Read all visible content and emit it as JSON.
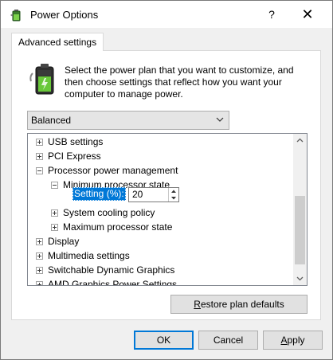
{
  "window": {
    "title": "Power Options",
    "help_glyph": "?",
    "close_glyph": "✕"
  },
  "tab": {
    "label": "Advanced settings"
  },
  "description": "Select the power plan that you want to customize, and then choose settings that reflect how you want your computer to manage power.",
  "plan_select": {
    "value": "Balanced"
  },
  "tree": {
    "items": [
      {
        "label": "USB settings",
        "expander": "+"
      },
      {
        "label": "PCI Express",
        "expander": "+"
      },
      {
        "label": "Processor power management",
        "expander": "-"
      },
      {
        "label": "Minimum processor state",
        "expander": "-"
      },
      {
        "label": "System cooling policy",
        "expander": "+"
      },
      {
        "label": "Maximum processor state",
        "expander": "+"
      },
      {
        "label": "Display",
        "expander": "+"
      },
      {
        "label": "Multimedia settings",
        "expander": "+"
      },
      {
        "label": "Switchable Dynamic Graphics",
        "expander": "+"
      },
      {
        "label": "AMD Graphics Power Settings",
        "expander": "+"
      }
    ],
    "setting": {
      "label": "Setting (%):",
      "value": "20"
    }
  },
  "buttons": {
    "restore_prefix": "",
    "restore_mnemonic": "R",
    "restore_rest": "estore plan defaults",
    "ok": "OK",
    "cancel": "Cancel",
    "apply_mnemonic": "A",
    "apply_rest": "pply"
  },
  "colors": {
    "selection": "#0078d7",
    "dialog_bg": "#f0f0f0",
    "panel_bg": "#ffffff"
  }
}
